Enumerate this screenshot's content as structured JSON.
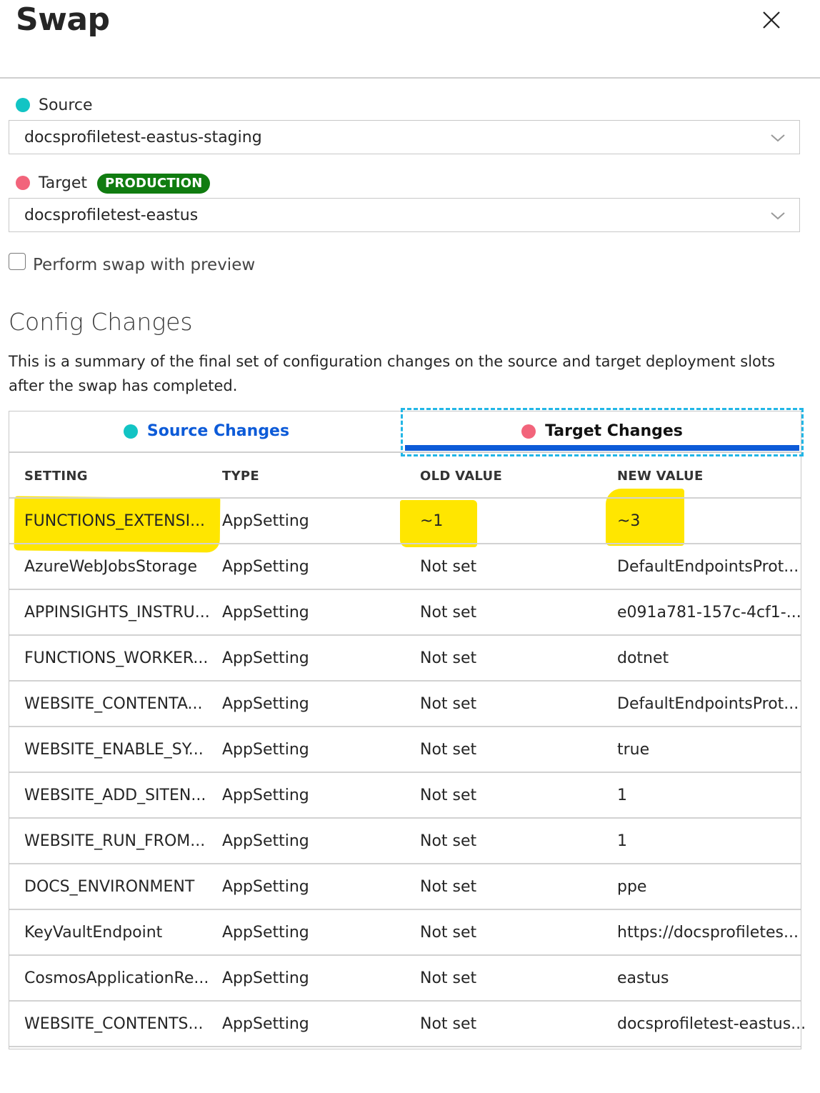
{
  "header": {
    "title": "Swap"
  },
  "source": {
    "label": "Source",
    "value": "docsprofiletest-eastus-staging",
    "dot_color": "#12c4c4"
  },
  "target": {
    "label": "Target",
    "badge": "PRODUCTION",
    "value": "docsprofiletest-eastus",
    "dot_color": "#f2647b"
  },
  "preview": {
    "label": "Perform swap with preview",
    "checked": false
  },
  "config": {
    "title": "Config Changes",
    "description": "This is a summary of the final set of configuration changes on the source and target deployment slots after the swap has completed."
  },
  "tabs": [
    {
      "label": "Source Changes",
      "selected": false
    },
    {
      "label": "Target Changes",
      "selected": true
    }
  ],
  "table": {
    "columns": [
      "SETTING",
      "TYPE",
      "OLD VALUE",
      "NEW VALUE"
    ],
    "rows": [
      [
        "FUNCTIONS_EXTENSI...",
        "AppSetting",
        "~1",
        "~3"
      ],
      [
        "AzureWebJobsStorage",
        "AppSetting",
        "Not set",
        "DefaultEndpointsProt..."
      ],
      [
        "APPINSIGHTS_INSTRU...",
        "AppSetting",
        "Not set",
        "e091a781-157c-4cf1-..."
      ],
      [
        "FUNCTIONS_WORKER...",
        "AppSetting",
        "Not set",
        "dotnet"
      ],
      [
        "WEBSITE_CONTENTA...",
        "AppSetting",
        "Not set",
        "DefaultEndpointsProt..."
      ],
      [
        "WEBSITE_ENABLE_SY...",
        "AppSetting",
        "Not set",
        "true"
      ],
      [
        "WEBSITE_ADD_SITEN...",
        "AppSetting",
        "Not set",
        "1"
      ],
      [
        "WEBSITE_RUN_FROM...",
        "AppSetting",
        "Not set",
        "1"
      ],
      [
        "DOCS_ENVIRONMENT",
        "AppSetting",
        "Not set",
        "ppe"
      ],
      [
        "KeyVaultEndpoint",
        "AppSetting",
        "Not set",
        "https://docsprofiletes..."
      ],
      [
        "CosmosApplicationRe...",
        "AppSetting",
        "Not set",
        "eastus"
      ],
      [
        "WEBSITE_CONTENTS...",
        "AppSetting",
        "Not set",
        "docsprofiletest-eastus..."
      ]
    ]
  },
  "colors": {
    "accent": "#0d5bd8",
    "highlight": "#ffe600",
    "badge": "#107c10"
  }
}
